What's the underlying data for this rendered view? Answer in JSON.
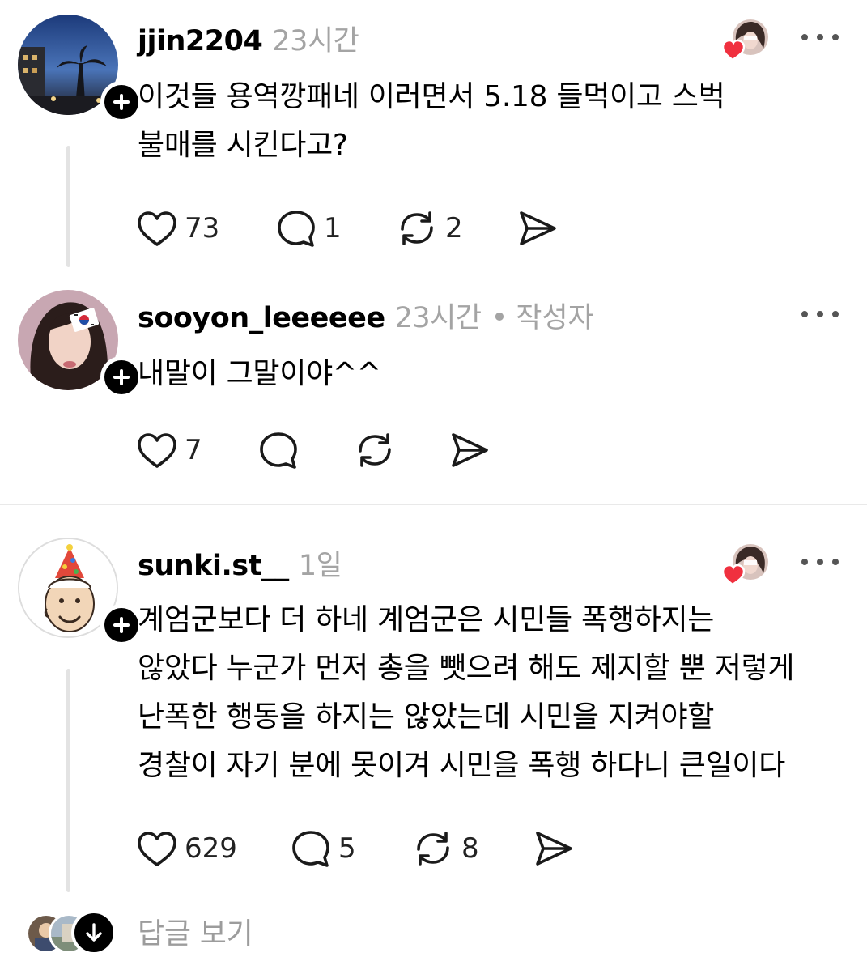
{
  "posts": [
    {
      "username": "jjin2204",
      "time": "23시간",
      "body": [
        "이것들 용역깡패네 이러면서 5.18 들먹이고 스벅",
        "불매를 시킨다고?"
      ],
      "liked_by_author": true,
      "likes": "73",
      "replies": "1",
      "reposts": "2"
    },
    {
      "username": "sooyon_leeeeee",
      "time": "23시간",
      "separator": "•",
      "author_tag": "작성자",
      "body": [
        "내말이 그말이야^^"
      ],
      "likes": "7",
      "replies": "",
      "reposts": ""
    },
    {
      "username": "sunki.st__",
      "time": "1일",
      "body": [
        "계엄군보다 더 하네  계엄군은 시민들 폭행하지는",
        "않았다 누군가 먼저 총을 뺏으려 해도 제지할 뿐 저렇게",
        "난폭한 행동을 하지는 않았는데 시민을 지켜야할",
        "경찰이 자기 분에 못이겨 시민을 폭행 하다니  큰일이다"
      ],
      "liked_by_author": true,
      "likes": "629",
      "replies": "5",
      "reposts": "8"
    }
  ],
  "view_replies_label": "답글 보기",
  "icons": {
    "like": "heart-outline-icon",
    "reply": "speech-bubble-icon",
    "repost": "repost-arrows-icon",
    "share": "paper-plane-icon",
    "more": "more-dots-icon",
    "follow": "plus-icon",
    "expand": "arrow-down-icon"
  },
  "colors": {
    "heart_red": "#f0303f",
    "meta_gray": "#a4a4a4",
    "line_gray": "#e3e3e3"
  }
}
